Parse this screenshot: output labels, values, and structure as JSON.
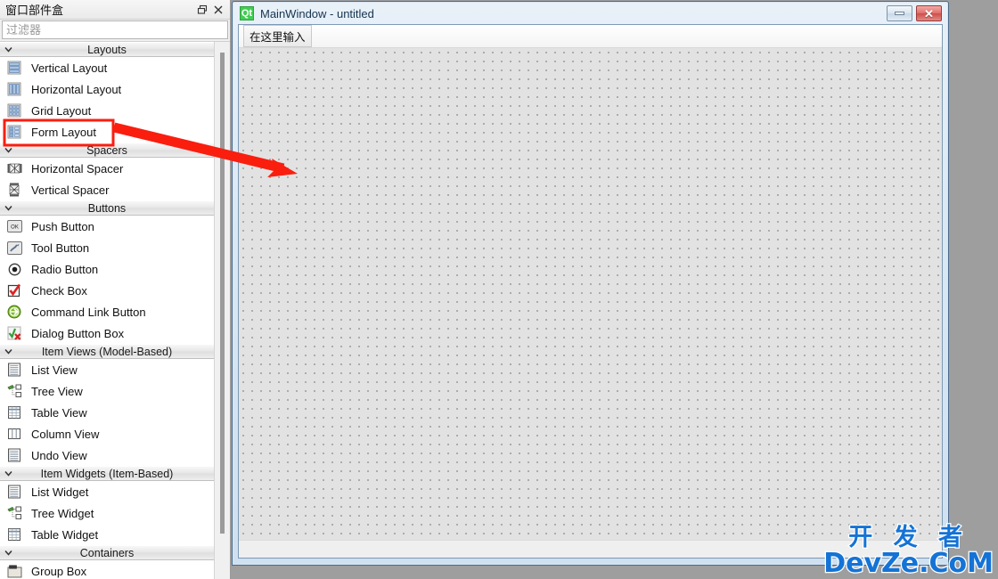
{
  "widget_box": {
    "title": "窗口部件盒",
    "float_icon": "restore-icon",
    "close_icon": "close-icon",
    "filter": {
      "value": "",
      "placeholder": "过滤器"
    },
    "categories": [
      {
        "name": "Layouts",
        "expanded": true,
        "items": [
          {
            "label": "Vertical Layout",
            "icon": "vertical-layout-icon"
          },
          {
            "label": "Horizontal Layout",
            "icon": "horizontal-layout-icon"
          },
          {
            "label": "Grid Layout",
            "icon": "grid-layout-icon"
          },
          {
            "label": "Form Layout",
            "icon": "form-layout-icon",
            "highlighted": true
          }
        ]
      },
      {
        "name": "Spacers",
        "expanded": true,
        "items": [
          {
            "label": "Horizontal Spacer",
            "icon": "horizontal-spacer-icon"
          },
          {
            "label": "Vertical Spacer",
            "icon": "vertical-spacer-icon"
          }
        ]
      },
      {
        "name": "Buttons",
        "expanded": true,
        "items": [
          {
            "label": "Push Button",
            "icon": "push-button-icon"
          },
          {
            "label": "Tool Button",
            "icon": "tool-button-icon"
          },
          {
            "label": "Radio Button",
            "icon": "radio-button-icon"
          },
          {
            "label": "Check Box",
            "icon": "check-box-icon"
          },
          {
            "label": "Command Link Button",
            "icon": "command-link-button-icon"
          },
          {
            "label": "Dialog Button Box",
            "icon": "dialog-button-box-icon"
          }
        ]
      },
      {
        "name": "Item Views (Model-Based)",
        "expanded": true,
        "items": [
          {
            "label": "List View",
            "icon": "list-view-icon"
          },
          {
            "label": "Tree View",
            "icon": "tree-view-icon"
          },
          {
            "label": "Table View",
            "icon": "table-view-icon"
          },
          {
            "label": "Column View",
            "icon": "column-view-icon"
          },
          {
            "label": "Undo View",
            "icon": "undo-view-icon"
          }
        ]
      },
      {
        "name": "Item Widgets (Item-Based)",
        "expanded": true,
        "items": [
          {
            "label": "List Widget",
            "icon": "list-widget-icon"
          },
          {
            "label": "Tree Widget",
            "icon": "tree-widget-icon"
          },
          {
            "label": "Table Widget",
            "icon": "table-widget-icon"
          }
        ]
      },
      {
        "name": "Containers",
        "expanded": true,
        "items": [
          {
            "label": "Group Box",
            "icon": "group-box-icon"
          }
        ]
      }
    ]
  },
  "main_window": {
    "logo_text": "Qt",
    "title": "MainWindow - untitled",
    "minimize_label": "",
    "close_label": "✕",
    "menubar": {
      "placeholder_item": "在这里输入"
    }
  },
  "annotations": {
    "highlight_color": "#fa1e0f",
    "highlight_target": "Form Layout",
    "arrow_color": "#fa1e0f"
  },
  "watermark": {
    "line1": "开 发 者",
    "line2": "DevZe.CoM",
    "color": "#1473d6"
  }
}
